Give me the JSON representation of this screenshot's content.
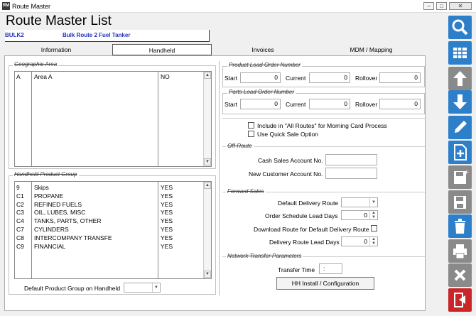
{
  "window": {
    "title": "Route Master"
  },
  "page_title": "Route Master List",
  "route": {
    "code": "BULK2",
    "name": "Bulk Route 2 Fuel Tanker"
  },
  "tabs": [
    {
      "label": "Information"
    },
    {
      "label": "Handheld"
    },
    {
      "label": "Invoices"
    },
    {
      "label": "MDM / Mapping"
    }
  ],
  "geo": {
    "title": "Geographic Area",
    "rows": [
      {
        "code": "A",
        "name": "Area A",
        "flag": "NO"
      }
    ]
  },
  "hpg": {
    "title": "Handheld Product Group",
    "rows": [
      {
        "code": "9",
        "name": "Skips",
        "flag": "YES"
      },
      {
        "code": "C1",
        "name": "PROPANE",
        "flag": "YES"
      },
      {
        "code": "C2",
        "name": "REFINED FUELS",
        "flag": "YES"
      },
      {
        "code": "C3",
        "name": "OIL, LUBES, MISC",
        "flag": "YES"
      },
      {
        "code": "C4",
        "name": "TANKS, PARTS, OTHER",
        "flag": "YES"
      },
      {
        "code": "C7",
        "name": "CYLINDERS",
        "flag": "YES"
      },
      {
        "code": "C8",
        "name": "INTERCOMPANY TRANSFE",
        "flag": "YES"
      },
      {
        "code": "C9",
        "name": "FINANCIAL",
        "flag": "YES"
      }
    ],
    "default_label": "Default Product Group on Handheld",
    "default_value": ""
  },
  "plon": {
    "title": "Product Load Order Number",
    "start_label": "Start",
    "start": "0",
    "current_label": "Current",
    "current": "0",
    "rollover_label": "Rollover",
    "rollover": "0"
  },
  "palon": {
    "title": "Parts Load Order Number",
    "start_label": "Start",
    "start": "0",
    "current_label": "Current",
    "current": "0",
    "rollover_label": "Rollover",
    "rollover": "0"
  },
  "options": {
    "include_all_routes": "Include in \"All Routes\" for Morning Card Process",
    "quick_sale": "Use Quick Sale Option"
  },
  "offroute": {
    "title": "Off-Route",
    "cash_label": "Cash Sales Account No.",
    "cash_value": "",
    "newcust_label": "New Customer Account No.",
    "newcust_value": ""
  },
  "forward": {
    "title": "Forward Sales",
    "ddr_label": "Default Delivery Route",
    "ddr_value": "",
    "oslt_label": "Order Schedule Lead Days",
    "oslt_value": "0",
    "download_label": "Download Route for Default Delivery Route",
    "drld_label": "Delivery Route Lead Days",
    "drld_value": "0"
  },
  "network": {
    "title": "Network Transfer Parameters",
    "time_label": "Transfer Time",
    "time_value": ":",
    "button": "HH Install / Configuration"
  },
  "sidebar": [
    "search-icon",
    "grid-icon",
    "arrow-up-icon",
    "arrow-down-icon",
    "pencil-icon",
    "new-document-icon",
    "save-new-icon",
    "save-icon",
    "delete-icon",
    "print-icon",
    "close-icon",
    "exit-icon"
  ],
  "colors": {
    "accent": "#2e7fc9",
    "disabled": "#8a8a8a",
    "exit": "#c9262a",
    "link_text": "#2233bb"
  }
}
